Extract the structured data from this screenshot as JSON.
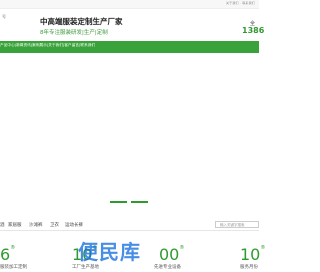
{
  "topbar": {
    "links": "关于我们 · 联系我们"
  },
  "header": {
    "brand_left": "号",
    "title": "中高端服装定制生产厂家",
    "subtitle": "8年专注服装研发|生产|定制",
    "hotline_label": "全",
    "hotline_number": "1386"
  },
  "nav": {
    "text": "产品中心|新闻资讯|案例展示|关于我们|客户留言|联系我们"
  },
  "categories": {
    "items": [
      "酒",
      "家居服",
      "沙滩裤",
      "卫衣",
      "运动长裤"
    ],
    "search_placeholder": "输入关键字搜索"
  },
  "stats": [
    {
      "number": "6",
      "label": "服装加工定制"
    },
    {
      "number": "10",
      "label": "工厂生产基地"
    },
    {
      "number": "00",
      "label": "先进专业设备"
    },
    {
      "number": "10",
      "label": "服务月份"
    }
  ],
  "watermark": {
    "text": "便民库"
  },
  "colors": {
    "accent": "#3aa23a",
    "stat": "#2f9b2f"
  }
}
